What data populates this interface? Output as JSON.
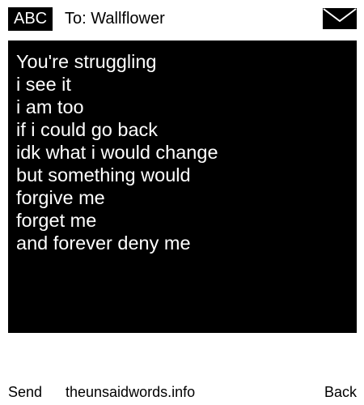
{
  "header": {
    "mode_label": "ABC",
    "recipient": "To: Wallflower",
    "icon": "envelope-icon"
  },
  "message": {
    "lines": [
      "You're struggling",
      "i see it",
      "i am too",
      "if i could go back",
      "idk what i would change",
      "but something would",
      "forgive me",
      "forget me",
      "and forever deny me"
    ]
  },
  "footer": {
    "send_label": "Send",
    "site_label": "theunsaidwords.info",
    "back_label": "Back"
  },
  "colors": {
    "background": "#ffffff",
    "message_background": "#000000",
    "message_text": "#ffffff",
    "text": "#000000"
  }
}
